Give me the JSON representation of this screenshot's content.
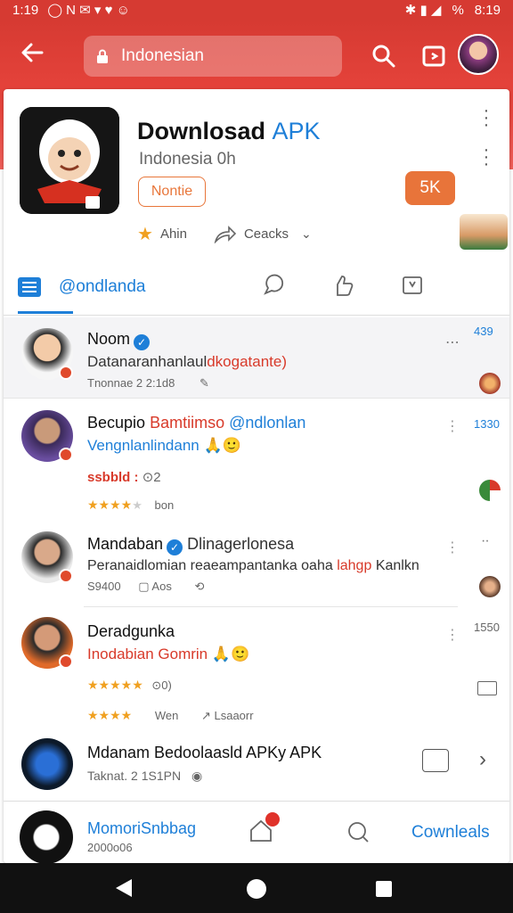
{
  "status_bar": {
    "time_left": "1:19",
    "time_right": "8:19",
    "battery": "%"
  },
  "header": {
    "search_text": "Indonesian"
  },
  "app": {
    "title_main": "Downlosad",
    "title_accent": "APK",
    "subtitle": "Indonesia 0h",
    "tag_label": "Nontie",
    "install_label": "5K",
    "meta_rating": "Ahin",
    "meta_share": "Ceacks"
  },
  "tabs": {
    "active_label": "@ondlanda"
  },
  "feed": [
    {
      "name": "Noom",
      "verified": true,
      "line2_dark": "Datanaranhanlaul",
      "line2_accent": "dkogatante)",
      "line3": "Tnonnae 2 2:1d8",
      "count": "439"
    },
    {
      "name_dark": "Becupio",
      "name_red": "Bamtiimso",
      "name_blue": "@ndlonlan",
      "line2_blue": "Vengnlanlindann",
      "line2_emoji": "🙏🙂",
      "line3_label": "ssbbld :",
      "line3_val": "2",
      "rating_text": "bon",
      "count": "1330"
    },
    {
      "name": "Mandaban",
      "name_blue": "Dlinagerlonesa",
      "verified": true,
      "line2_dark": "Peranaidlomian reaeampantanka oaha",
      "line2_red": "lahgp",
      "line2_tail": "Kanlkn",
      "line3_a": "S9400",
      "line3_b": "Aos"
    },
    {
      "name": "Deradgunka",
      "line2_red": "Inodabian Gomrin",
      "line2_emoji": "🙏🙂",
      "rating_val": "0)",
      "rating_text2": "Wen",
      "rating_text3": "Lsaaorr",
      "count": "1550"
    },
    {
      "title": "Mdanam Bedoolaasld APKy APK",
      "line3": "Taknat. 2 1S1PN"
    }
  ],
  "bottom": {
    "name": "MomoriSnbbag",
    "sub": "2000o06",
    "notif_count": "",
    "downloads_label": "Cownleals"
  }
}
